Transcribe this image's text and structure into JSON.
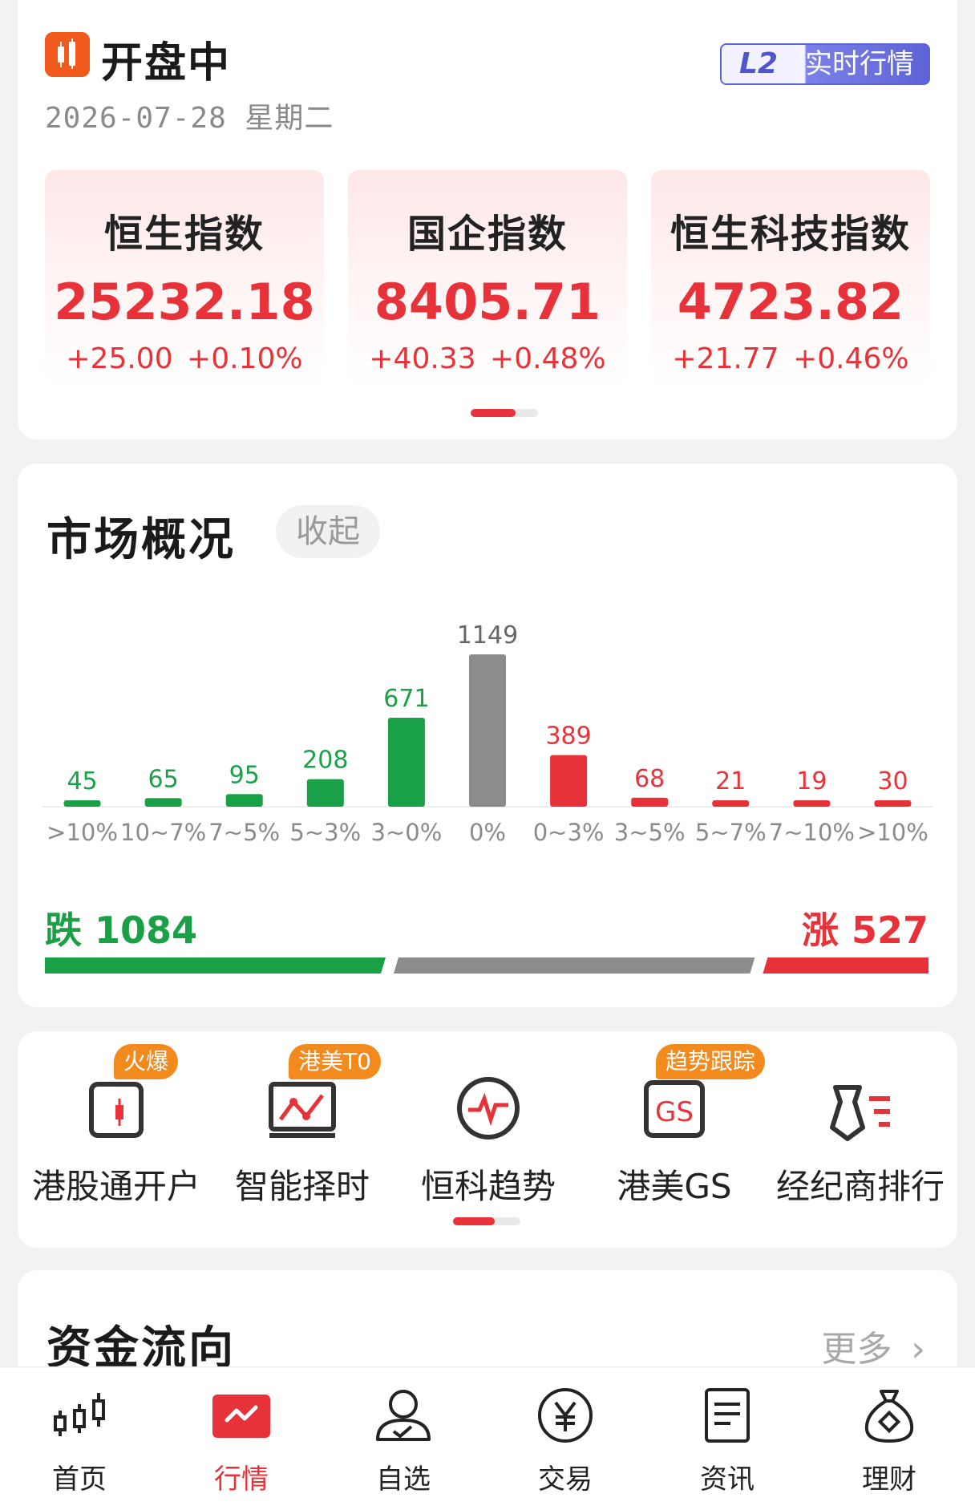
{
  "status": {
    "icon": "candlestick-icon",
    "title": "开盘中",
    "date": "2026-07-28 星期二",
    "badge_l2": "L2",
    "badge_text": "实时行情"
  },
  "indices": [
    {
      "name": "恒生指数",
      "value": "25232.18",
      "change": "+25.00 +0.10%"
    },
    {
      "name": "国企指数",
      "value": "8405.71",
      "change": "+40.33 +0.48%"
    },
    {
      "name": "恒生科技指数",
      "value": "4723.82",
      "change": "+21.77 +0.46%"
    }
  ],
  "market": {
    "title": "市场概况",
    "collapse_label": "收起",
    "fall_label": "跌",
    "fall_count": "1084",
    "rise_label": "涨",
    "rise_count": "527",
    "ratio": {
      "fall": 1084,
      "flat": 1149,
      "rise": 527
    }
  },
  "chart_data": {
    "type": "bar",
    "categories": [
      ">10%",
      "10~7%",
      "7~5%",
      "5~3%",
      "3~0%",
      "0%",
      "0~3%",
      "3~5%",
      "5~7%",
      "7~10%",
      ">10%"
    ],
    "values": [
      45,
      65,
      95,
      208,
      671,
      1149,
      389,
      68,
      21,
      19,
      30
    ],
    "colors": [
      "#1aa047",
      "#1aa047",
      "#1aa047",
      "#1aa047",
      "#1aa047",
      "#8c8c8c",
      "#e8323a",
      "#e8323a",
      "#e8323a",
      "#e8323a",
      "#e8323a"
    ],
    "title": "",
    "xlabel": "",
    "ylabel": ""
  },
  "tools": [
    {
      "label": "港股通开户",
      "icon": "card-account-icon",
      "tag": "火爆"
    },
    {
      "label": "智能择时",
      "icon": "smart-timing-icon",
      "tag": "港美T0"
    },
    {
      "label": "恒科趋势",
      "icon": "trend-pulse-icon",
      "tag": ""
    },
    {
      "label": "港美GS",
      "icon": "gs-icon",
      "tag": "趋势跟踪"
    },
    {
      "label": "经纪商排行",
      "icon": "broker-tie-icon",
      "tag": ""
    }
  ],
  "flow": {
    "title": "资金流向",
    "more_label": "更多"
  },
  "nav": [
    {
      "label": "首页",
      "icon": "home-candle-icon"
    },
    {
      "label": "行情",
      "icon": "market-chart-icon"
    },
    {
      "label": "自选",
      "icon": "watchlist-person-icon"
    },
    {
      "label": "交易",
      "icon": "yen-coin-icon"
    },
    {
      "label": "资讯",
      "icon": "news-doc-icon"
    },
    {
      "label": "理财",
      "icon": "money-bag-icon"
    }
  ],
  "colors": {
    "rise": "#e8323a",
    "fall": "#1aa047",
    "flat": "#8c8c8c",
    "accent": "#e8323a",
    "tag": "#f28a1e"
  }
}
